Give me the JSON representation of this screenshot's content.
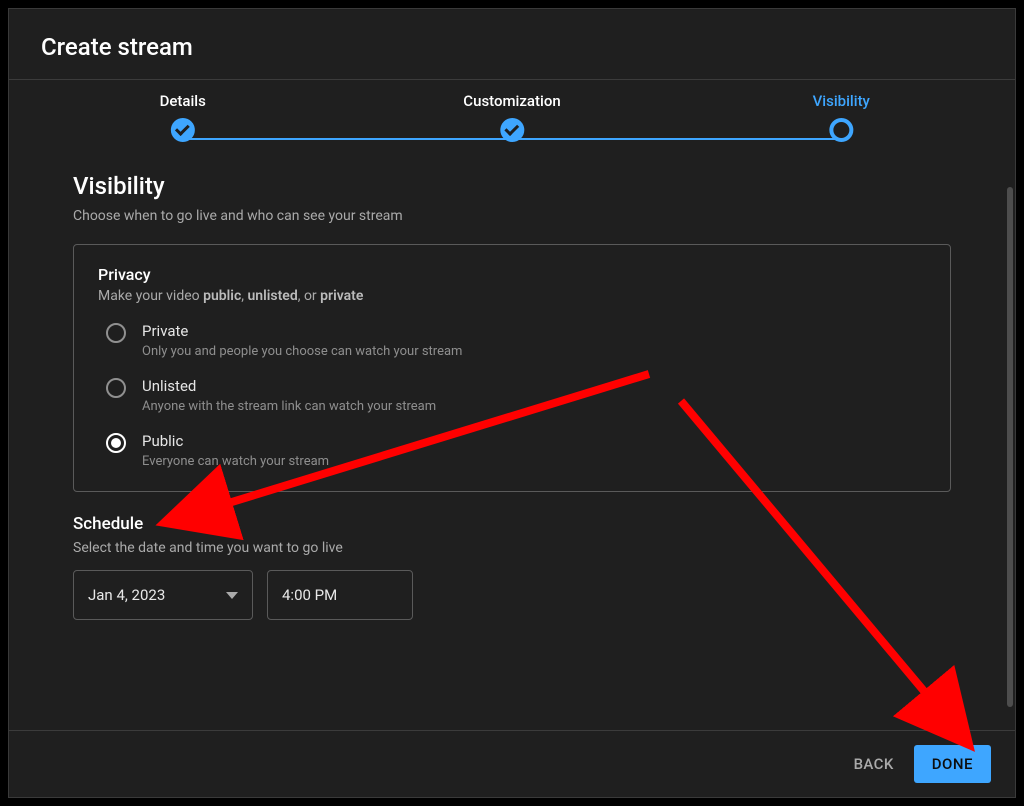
{
  "dialog": {
    "title": "Create stream"
  },
  "stepper": {
    "steps": [
      {
        "label": "Details"
      },
      {
        "label": "Customization"
      },
      {
        "label": "Visibility"
      }
    ]
  },
  "visibility": {
    "title": "Visibility",
    "subtitle": "Choose when to go live and who can see your stream",
    "privacy": {
      "title": "Privacy",
      "subtitle_prefix": "Make your video ",
      "subtitle_bold1": "public",
      "subtitle_sep1": ", ",
      "subtitle_bold2": "unlisted",
      "subtitle_sep2": ", or ",
      "subtitle_bold3": "private",
      "options": [
        {
          "label": "Private",
          "desc": "Only you and people you choose can watch your stream",
          "selected": false
        },
        {
          "label": "Unlisted",
          "desc": "Anyone with the stream link can watch your stream",
          "selected": false
        },
        {
          "label": "Public",
          "desc": "Everyone can watch your stream",
          "selected": true
        }
      ]
    },
    "schedule": {
      "title": "Schedule",
      "subtitle": "Select the date and time you want to go live",
      "date": "Jan 4, 2023",
      "time": "4:00 PM"
    }
  },
  "footer": {
    "back": "BACK",
    "done": "DONE"
  }
}
